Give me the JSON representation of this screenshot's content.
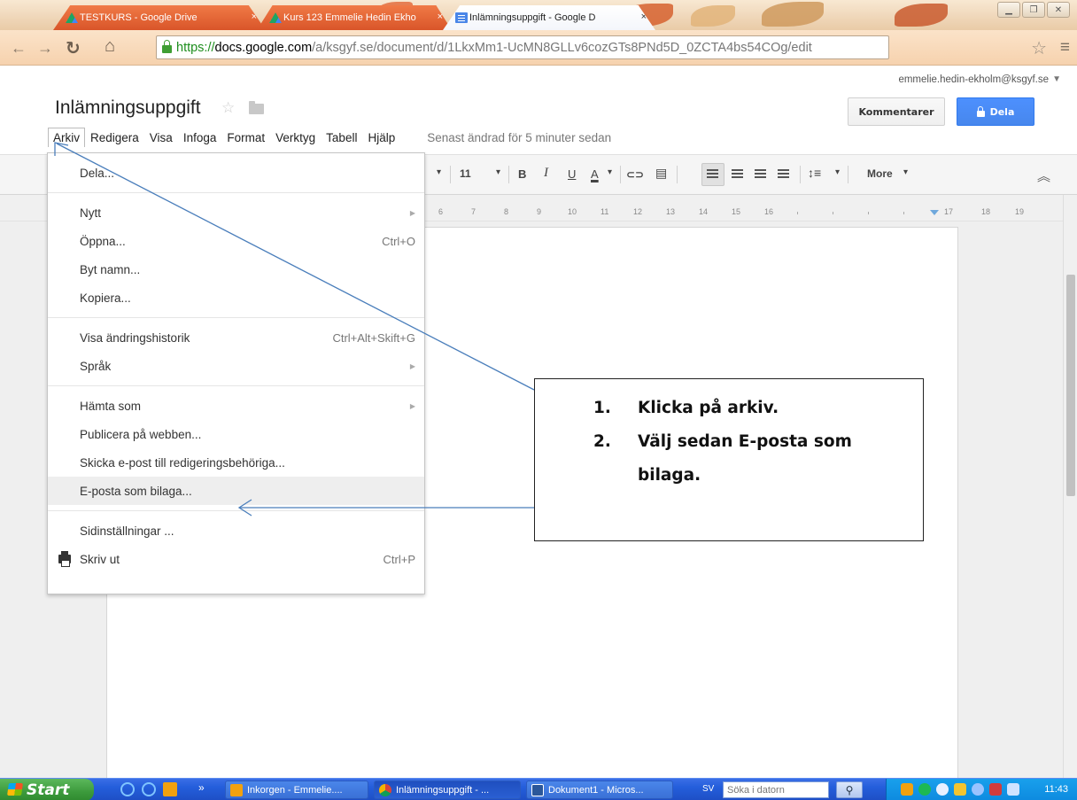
{
  "browser": {
    "tabs": [
      {
        "title": "TESTKURS - Google Drive",
        "close": "×",
        "icon": "google-drive-icon",
        "active": false
      },
      {
        "title": "Kurs 123 Emmelie Hedin Ekho",
        "close": "×",
        "icon": "google-drive-icon",
        "active": false
      },
      {
        "title": "Inlämningsuppgift - Google D",
        "close": "×",
        "icon": "google-docs-icon",
        "active": true
      }
    ],
    "url": {
      "scheme": "https://",
      "host": "docs.google.com",
      "path": "/a/ksgyf.se/document/d/1LkxMm1-UcMN8GLLv6cozGTs8PNd5D_0ZCTA4bs54COg/edit"
    }
  },
  "docs": {
    "title": "Inlämningsuppgift",
    "user_email": "emmelie.hedin-ekholm@ksgyf.se",
    "comments_label": "Kommentarer",
    "share_label": "Dela",
    "menu": [
      "Arkiv",
      "Redigera",
      "Visa",
      "Infoga",
      "Format",
      "Verktyg",
      "Tabell",
      "Hjälp"
    ],
    "last_edited": "Senast ändrad för 5 minuter sedan",
    "toolbar": {
      "font_size": "11",
      "bold": "B",
      "italic": "I",
      "underline": "U",
      "text_color": "A",
      "more_label": "More"
    },
    "ruler_numbers": [
      "6",
      "7",
      "8",
      "9",
      "10",
      "11",
      "12",
      "13",
      "14",
      "15",
      "16",
      "17",
      "18",
      "19"
    ]
  },
  "file_menu": {
    "groups": [
      [
        {
          "label": "Dela..."
        }
      ],
      [
        {
          "label": "Nytt",
          "submenu": true
        },
        {
          "label": "Öppna...",
          "shortcut": "Ctrl+O"
        },
        {
          "label": "Byt namn..."
        },
        {
          "label": "Kopiera..."
        }
      ],
      [
        {
          "label": "Visa ändringshistorik",
          "shortcut": "Ctrl+Alt+Skift+G"
        },
        {
          "label": "Språk",
          "submenu": true
        }
      ],
      [
        {
          "label": "Hämta som",
          "submenu": true
        },
        {
          "label": "Publicera på webben..."
        },
        {
          "label": "Skicka e-post till redigeringsbehöriga..."
        },
        {
          "label": "E-posta som bilaga...",
          "highlighted": true
        }
      ],
      [
        {
          "label": "Sidinställningar ..."
        },
        {
          "label": "Skriv ut",
          "shortcut": "Ctrl+P",
          "icon": "printer-icon"
        }
      ]
    ]
  },
  "callout": {
    "items": [
      {
        "number": "1.",
        "text": "Klicka på arkiv."
      },
      {
        "number": "2.",
        "text": "Välj sedan E-posta som"
      },
      {
        "number": "",
        "text": "bilaga."
      }
    ]
  },
  "taskbar": {
    "start_label": "Start",
    "tasks": [
      {
        "label": "Inkorgen - Emmelie....",
        "icon": "outlook-icon"
      },
      {
        "label": "Inlämningsuppgift - ...",
        "icon": "chrome-icon",
        "active": true
      },
      {
        "label": "Dokument1 - Micros...",
        "icon": "word-icon"
      }
    ],
    "language": "SV",
    "search_placeholder": "Söka i datorn",
    "clock": "11:43"
  },
  "colors": {
    "share_blue": "#4d90fe",
    "arrow_blue": "#4a7ebb",
    "taskbar_blue": "#245edb",
    "start_green": "#3c9a3c"
  }
}
